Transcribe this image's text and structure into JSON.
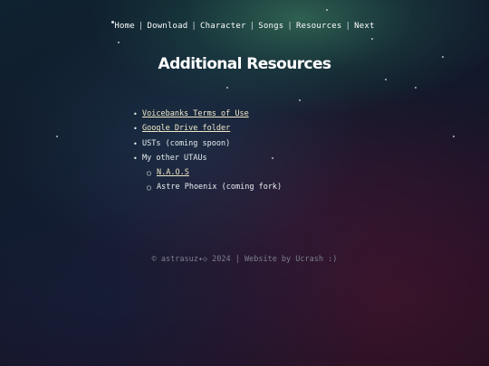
{
  "nav": {
    "items": [
      "Home",
      "Download",
      "Character",
      "Songs",
      "Resources",
      "Next"
    ],
    "separator": "|"
  },
  "title": "Additional Resources",
  "resources": {
    "items": [
      {
        "text": "Voicebanks Terms of Use",
        "link": true
      },
      {
        "text": "Google Drive folder",
        "link": true
      },
      {
        "text": "USTs (coming spoon)",
        "link": false
      },
      {
        "text": "My other UTAUs",
        "link": false
      }
    ],
    "sub_items": [
      {
        "text": "N.A.O.S",
        "link": true
      },
      {
        "text": "Astre Phoenix (coming fork)",
        "link": false
      }
    ],
    "bullet": "•",
    "sub_bullet": "○"
  },
  "footer": "© astrasuz✦◇ 2024 | Website by Ucrash :)"
}
